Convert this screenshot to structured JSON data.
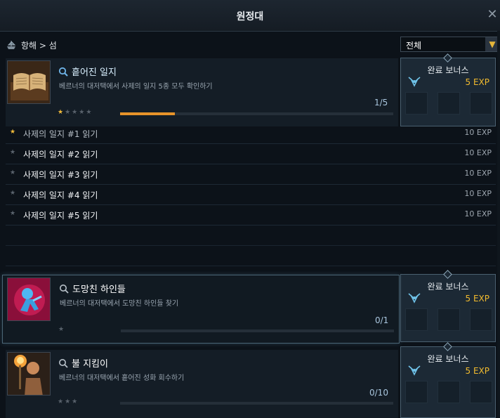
{
  "window": {
    "title": "원정대"
  },
  "breadcrumb": {
    "text": "항해 > 섬"
  },
  "filter": {
    "selected": "전체"
  },
  "quests": [
    {
      "name": "흩어진 일지",
      "description": "베르너의 대저택에서 사제의 일지 5종 모두 확인하기",
      "progress": "1/5",
      "progress_fraction": 0.2,
      "stars_filled": 1,
      "stars_total": 5,
      "bonus": {
        "label": "완료 보너스",
        "exp": "5 EXP"
      },
      "objectives": [
        {
          "label": "사제의 일지 #1 읽기",
          "exp": "10 EXP",
          "done": true
        },
        {
          "label": "사제의 일지 #2 읽기",
          "exp": "10 EXP",
          "done": false
        },
        {
          "label": "사제의 일지 #3 읽기",
          "exp": "10 EXP",
          "done": false
        },
        {
          "label": "사제의 일지 #4 읽기",
          "exp": "10 EXP",
          "done": false
        },
        {
          "label": "사제의 일지 #5 읽기",
          "exp": "10 EXP",
          "done": false
        }
      ]
    },
    {
      "name": "도망친 하인들",
      "description": "베르너의 대저택에서 도망친 하인들 찾기",
      "progress": "0/1",
      "progress_fraction": 0,
      "stars_filled": 0,
      "stars_total": 1,
      "bonus": {
        "label": "완료 보너스",
        "exp": "5 EXP"
      }
    },
    {
      "name": "불 지킴이",
      "description": "베르너의 대저택에서 흩어진 성화 회수하기",
      "progress": "0/10",
      "progress_fraction": 0,
      "stars_filled": 0,
      "stars_total": 3,
      "bonus": {
        "label": "완료 보너스",
        "exp": "5 EXP"
      }
    }
  ],
  "colors": {
    "accent_gold": "#f2bb2e",
    "progress_orange": "#e7932a",
    "panel_bg": "#141d26"
  },
  "icons": [
    "close-icon",
    "ship-icon",
    "chevron-down-icon",
    "magnifier-icon",
    "star-icon",
    "emblem-icon"
  ]
}
